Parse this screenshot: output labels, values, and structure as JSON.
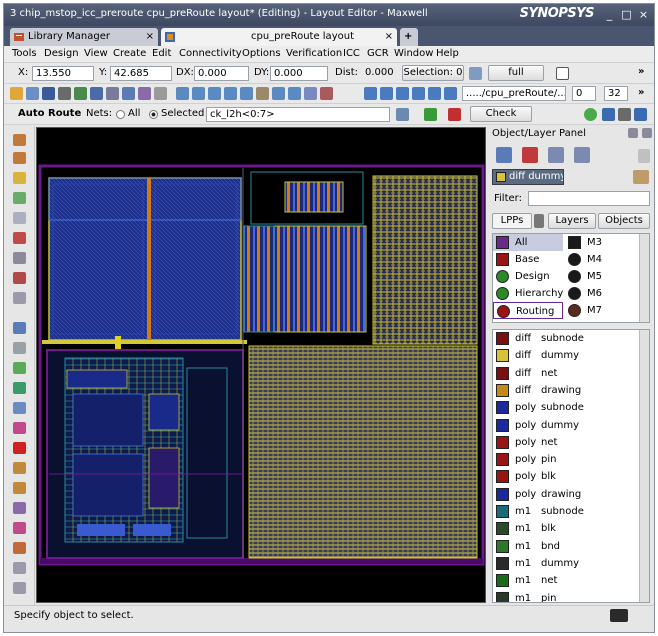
{
  "window": {
    "title": "3 chip_mstop_icc_preroute cpu_preRoute layout* (Editing) - Layout Editor - Maxwell",
    "brand": "SYNOPSYS",
    "controls": [
      "_",
      "□",
      "×"
    ]
  },
  "tabs": [
    {
      "label": "Library Manager",
      "close": "×",
      "active": false
    },
    {
      "label": "cpu_preRoute layout",
      "close": "×",
      "active": true
    },
    {
      "label": "+",
      "active": false
    }
  ],
  "menu": [
    "Tools",
    "Design",
    "View",
    "Create",
    "Edit",
    "Connectivity",
    "Options",
    "Verification",
    "ICC",
    "GCR",
    "Window",
    "Help"
  ],
  "coords": {
    "x_label": "X:",
    "x_value": "13.550",
    "y_label": "Y:",
    "y_value": "42.685",
    "dx_label": "DX:",
    "dx_value": "0.000",
    "dy_label": "DY:",
    "dy_value": "0.000",
    "dist_label": "Dist:",
    "dist_value": "0.000",
    "selection": "Selection: 0",
    "full": "full",
    "more": "»"
  },
  "toolbar2": {
    "path": "...../cpu_preRoute/...",
    "level_from": "0",
    "level_to": "32",
    "more": "»"
  },
  "autoroute": {
    "label": "Auto Route",
    "nets_label": "Nets:",
    "all_label": "All",
    "selected_label": "Selected",
    "net_value": "ck_l2h<0:7>",
    "check_label": "Check"
  },
  "panel": {
    "title": "Object/Layer Panel",
    "layer_select": "diff dummy",
    "filter_label": "Filter:",
    "filter_value": "",
    "tabs": [
      "LPPs",
      "Layers",
      "Objects"
    ],
    "groups_left": [
      "All",
      "Base",
      "Design",
      "Hierarchy",
      "Routing"
    ],
    "groups_right": [
      "M3",
      "M4",
      "M5",
      "M6",
      "M7"
    ],
    "lpps": [
      {
        "layer": "diff",
        "purpose": "subnode",
        "color": "#7a1010"
      },
      {
        "layer": "diff",
        "purpose": "dummy",
        "color": "#d8c23a"
      },
      {
        "layer": "diff",
        "purpose": "net",
        "color": "#7a1010"
      },
      {
        "layer": "diff",
        "purpose": "drawing",
        "color": "#c48a1a"
      },
      {
        "layer": "poly",
        "purpose": "subnode",
        "color": "#1a2a9a"
      },
      {
        "layer": "poly",
        "purpose": "dummy",
        "color": "#1a2a9a"
      },
      {
        "layer": "poly",
        "purpose": "net",
        "color": "#9a1414"
      },
      {
        "layer": "poly",
        "purpose": "pin",
        "color": "#9a1414"
      },
      {
        "layer": "poly",
        "purpose": "blk",
        "color": "#9a1414"
      },
      {
        "layer": "poly",
        "purpose": "drawing",
        "color": "#1a2a9a"
      },
      {
        "layer": "m1",
        "purpose": "subnode",
        "color": "#1a6a7a"
      },
      {
        "layer": "m1",
        "purpose": "blk",
        "color": "#2a4a2a"
      },
      {
        "layer": "m1",
        "purpose": "bnd",
        "color": "#2a7a2a"
      },
      {
        "layer": "m1",
        "purpose": "dummy",
        "color": "#2a2a2a"
      },
      {
        "layer": "m1",
        "purpose": "net",
        "color": "#1a6a1a"
      },
      {
        "layer": "m1",
        "purpose": "pin",
        "color": "#2a3a2a"
      }
    ]
  },
  "status": {
    "text": "Specify object to select."
  },
  "colors": {
    "titlebar": "#3d4860",
    "canvas": "#000000",
    "metal_blue": "#1e3aa8",
    "metal_orange": "#d07a18",
    "metal_yellow": "#d2c93a",
    "purple": "#6a1a8a"
  }
}
